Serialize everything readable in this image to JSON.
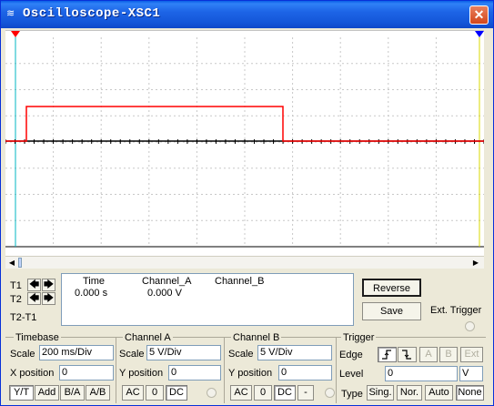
{
  "window": {
    "title": "Oscilloscope-XSC1",
    "close_glyph": "✕"
  },
  "screen": {
    "background": "#ffffff",
    "grid_color": "#c8c8c8",
    "grid_cols": 10,
    "grid_rows": 8,
    "channel_a_color": "#ff0000",
    "channel_b_color": "#000000",
    "t1_color": "#ff0000",
    "t2_color": "#0000ff"
  },
  "readout": {
    "col_time": "Time",
    "col_channel_a": "Channel_A",
    "col_channel_b": "Channel_B",
    "t1_label": "T1",
    "t2_label": "T2",
    "t2t1_label": "T2-T1",
    "time_value": "0.000 s",
    "channel_a_value": "0.000 V",
    "channel_b_value": ""
  },
  "actions": {
    "reverse": "Reverse",
    "save": "Save",
    "ext_trigger": "Ext. Trigger"
  },
  "timebase": {
    "header": "Timebase",
    "scale_label": "Scale",
    "scale_value": "200 ms/Div",
    "xpos_label": "X position",
    "xpos_value": "0",
    "modes": [
      "Y/T",
      "Add",
      "B/A",
      "A/B"
    ]
  },
  "channel_a": {
    "header": "Channel A",
    "scale_label": "Scale",
    "scale_value": "5  V/Div",
    "ypos_label": "Y position",
    "ypos_value": "0",
    "coupling": [
      "AC",
      "0",
      "DC"
    ]
  },
  "channel_b": {
    "header": "Channel B",
    "scale_label": "Scale",
    "scale_value": "5  V/Div",
    "ypos_label": "Y position",
    "ypos_value": "0",
    "coupling": [
      "AC",
      "0",
      "DC",
      "-"
    ]
  },
  "trigger": {
    "header": "Trigger",
    "edge_label": "Edge",
    "edge_buttons": [
      "rising-edge",
      "falling-edge"
    ],
    "source_buttons": [
      "A",
      "B",
      "Ext"
    ],
    "level_label": "Level",
    "level_value": "0",
    "level_unit": "V",
    "type_label": "Type",
    "types": [
      "Sing.",
      "Nor.",
      "Auto",
      "None"
    ]
  }
}
